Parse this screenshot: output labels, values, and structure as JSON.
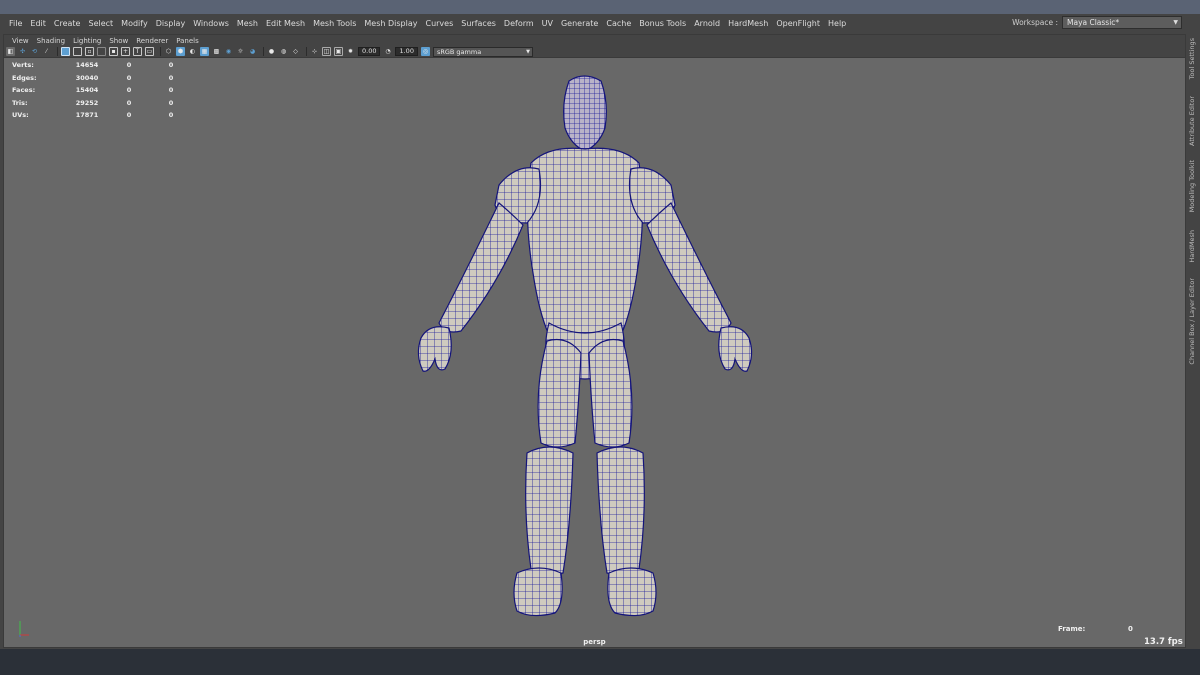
{
  "menubar": {
    "items": [
      "File",
      "Edit",
      "Create",
      "Select",
      "Modify",
      "Display",
      "Windows",
      "Mesh",
      "Edit Mesh",
      "Mesh Tools",
      "Mesh Display",
      "Curves",
      "Surfaces",
      "Deform",
      "UV",
      "Generate",
      "Cache",
      "Bonus Tools",
      "Arnold",
      "HardMesh",
      "OpenFlight",
      "Help"
    ]
  },
  "workspace": {
    "label": "Workspace :",
    "value": "Maya Classic*"
  },
  "panel_menu": {
    "items": [
      "View",
      "Shading",
      "Lighting",
      "Show",
      "Renderer",
      "Panels"
    ]
  },
  "panel_toolbar": {
    "exposure": "0.00",
    "gamma": "1.00",
    "color_space": "sRGB gamma",
    "accent_color": "#5d9fd1"
  },
  "hud": {
    "rows": [
      {
        "label": "Verts:",
        "v1": "14654",
        "v2": "0",
        "v3": "0"
      },
      {
        "label": "Edges:",
        "v1": "30040",
        "v2": "0",
        "v3": "0"
      },
      {
        "label": "Faces:",
        "v1": "15404",
        "v2": "0",
        "v3": "0"
      },
      {
        "label": "Tris:",
        "v1": "29252",
        "v2": "0",
        "v3": "0"
      },
      {
        "label": "UVs:",
        "v1": "17871",
        "v2": "0",
        "v3": "0"
      }
    ]
  },
  "viewport": {
    "camera": "persp",
    "frame_label": "Frame:",
    "frame_value": "0",
    "fps": "13.7 fps",
    "wire_color": "#1a1a9a",
    "surface_color": "#cfcbbf",
    "background_color": "#686868"
  },
  "side_tabs": [
    "Tool Settings",
    "Attribute Editor",
    "Modeling Toolkit",
    "HardMesh",
    "Channel Box / Layer Editor"
  ],
  "icons": [
    "select-camera-icon",
    "lock-camera-icon",
    "camera-attributes-icon",
    "bookmarks-icon",
    "image-plane-icon",
    "grid-icon",
    "film-gate-icon",
    "resolution-gate-icon",
    "gate-mask-icon",
    "field-chart-icon",
    "safe-action-icon",
    "safe-title-icon",
    "wireframe-icon",
    "smooth-shade-icon",
    "default-material-icon",
    "textured-icon",
    "use-all-lights-icon",
    "shadows-icon",
    "screen-space-ao-icon",
    "motion-blur-icon",
    "anti-aliasing-icon",
    "depth-of-field-icon",
    "isolate-select-icon",
    "xray-icon",
    "xray-joints-icon",
    "xray-components-icon",
    "exposure-icon",
    "gamma-icon",
    "color-management-icon"
  ]
}
